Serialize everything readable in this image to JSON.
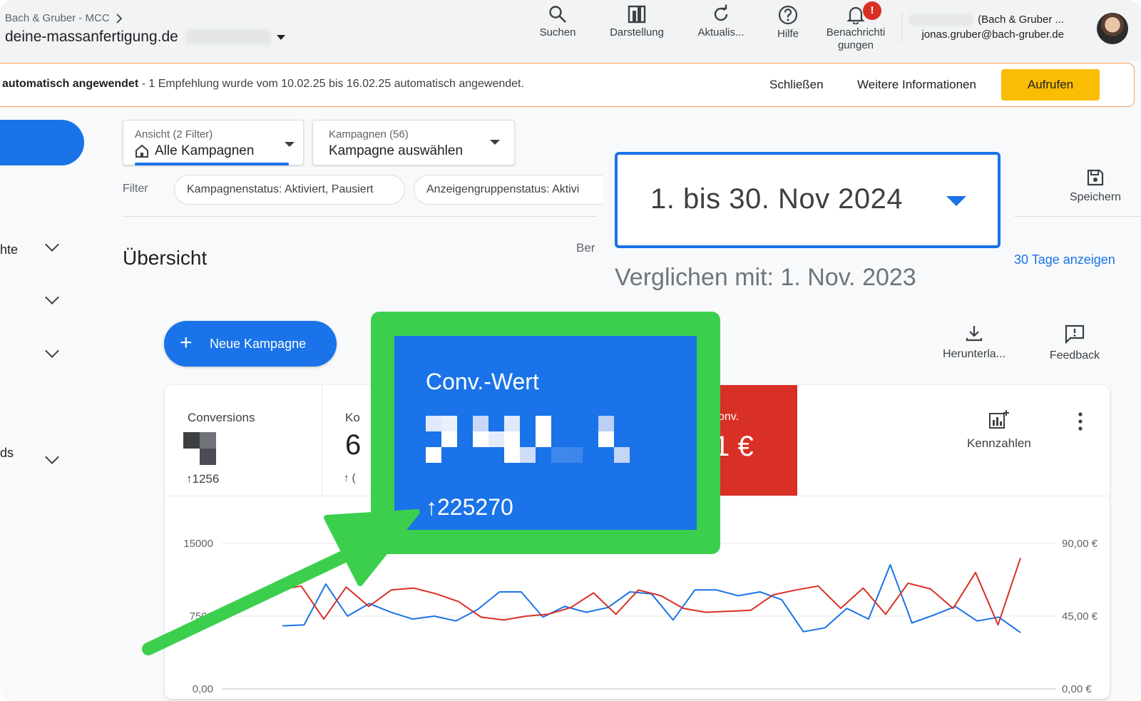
{
  "header": {
    "breadcrumb": "Bach & Gruber - MCC",
    "account_name": "deine-massanfertigung.de",
    "tools": [
      {
        "label": "Suchen",
        "icon": "search-icon"
      },
      {
        "label": "Darstellung",
        "icon": "appearance-icon"
      },
      {
        "label": "Aktualis...",
        "icon": "refresh-icon"
      },
      {
        "label": "Hilfe",
        "icon": "help-icon"
      },
      {
        "label": "Benachrichti\ngungen",
        "icon": "bell-icon",
        "badge": "!"
      }
    ],
    "user_org": "(Bach & Gruber ...",
    "user_email": "jonas.gruber@bach-gruber.de"
  },
  "banner": {
    "text_bold": "automatisch angewendet",
    "text_rest": " - 1 Empfehlung wurde vom 10.02.25 bis 16.02.25 automatisch angewendet.",
    "close_label": "Schließen",
    "info_label": "Weitere Informationen",
    "open_label": "Aufrufen",
    "accent": "#fbbc04"
  },
  "sidebar": {
    "items": [
      {
        "label": "hte"
      },
      {
        "label": ""
      },
      {
        "label": ""
      },
      {
        "label": "ds"
      }
    ]
  },
  "selectors": {
    "view_small": "Ansicht (2 Filter)",
    "view_main": "Alle Kampagnen",
    "campaigns_small": "Kampagnen (56)",
    "campaigns_main": "Kampagne auswählen"
  },
  "filters": {
    "label": "Filter",
    "chips": [
      "Kampagnenstatus: Aktiviert, Pausiert",
      "Anzeigengruppenstatus: Aktivi"
    ]
  },
  "overview": {
    "title": "Übersicht",
    "partial_text": "Ber"
  },
  "date": {
    "range": "1. bis 30. Nov 2024",
    "compare": "Verglichen mit: 1. Nov. 2023",
    "save_label": "Speichern",
    "days_link": "30 Tage anzeigen"
  },
  "actions": {
    "new_campaign": "Neue Kampagne",
    "download": "Herunterla...",
    "feedback": "Feedback"
  },
  "tiles": {
    "conversions_label": "Conversions",
    "conversions_delta": "1256",
    "ko_label": "Ko",
    "ko_value": "6",
    "ko_delta": "(",
    "red_label": "onv.",
    "red_value": "1 €",
    "kennzahlen": "Kennzahlen"
  },
  "magnified": {
    "label": "Conv.-Wert",
    "delta": "225270"
  },
  "colors": {
    "blue": "#1a73e8",
    "red": "#d93025",
    "green_highlight": "#3ccf4e",
    "orange_border": "#f5a261"
  },
  "chart_data": {
    "type": "line",
    "left_ticks": [
      "15000",
      "7500",
      "0,00"
    ],
    "right_ticks": [
      "90,00 €",
      "45,00 €",
      "0,00 €"
    ],
    "ylim_left": [
      0,
      15000
    ],
    "ylim_right": [
      0,
      90
    ],
    "series": [
      {
        "color": "#1a73e8",
        "axis": "left",
        "values": [
          6500,
          6600,
          10800,
          7500,
          8800,
          7900,
          7200,
          7500,
          7000,
          8200,
          10000,
          10000,
          7400,
          8500,
          7900,
          8400,
          10000,
          9800,
          7100,
          10200,
          10200,
          9600,
          10000,
          9200,
          5900,
          6300,
          8300,
          7200,
          12800,
          6800,
          7600,
          8500,
          7000,
          7400,
          5800
        ]
      },
      {
        "color": "#d93025",
        "axis": "left",
        "values": [
          10200,
          10600,
          7200,
          10500,
          8500,
          10200,
          10400,
          9800,
          9000,
          7400,
          7100,
          7500,
          7700,
          8400,
          9900,
          7700,
          10200,
          9600,
          8300,
          7900,
          8000,
          8100,
          9700,
          10200,
          10600,
          8300,
          10400,
          7700,
          10900,
          10300,
          8300,
          12000,
          6600,
          13500
        ]
      }
    ]
  }
}
